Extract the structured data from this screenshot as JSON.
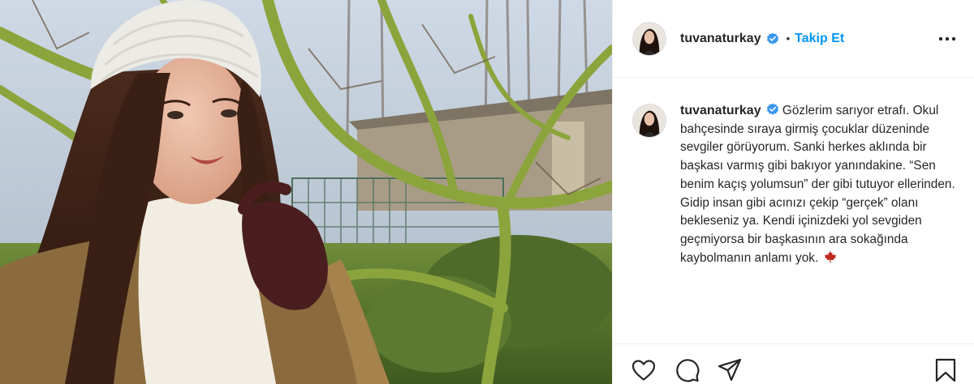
{
  "post": {
    "author": {
      "username": "tuvanaturkay",
      "verified": true,
      "separator": "•",
      "follow_label": "Takip Et"
    },
    "caption": {
      "username": "tuvanaturkay",
      "text": "Gözlerim sarıyor etrafı. Okul bahçesinde sıraya girmiş çocuklar düzeninde sevgiler görüyorum. Sanki herkes aklında bir başkası varmış gibi bakıyor yanındakine. “Sen benim kaçış yolumsun” der gibi tutuyor ellerinden. Gidip insan gibi acınızı çekip “gerçek” olanı bekleseniz ya. Kendi içinizdeki yol sevgiden geçmiyorsa bir başkasının ara sokağında kaybolmanın anlamı yok.",
      "emoji": "maple-leaf-icon"
    },
    "icons": {
      "more": "more-options-icon",
      "like": "heart-icon",
      "comment": "comment-icon",
      "share": "share-icon",
      "save": "bookmark-icon",
      "verified": "verified-badge-icon"
    },
    "colors": {
      "accent": "#0095f6",
      "text": "#262626",
      "border": "#efefef",
      "leaf": "#c0281d"
    }
  }
}
